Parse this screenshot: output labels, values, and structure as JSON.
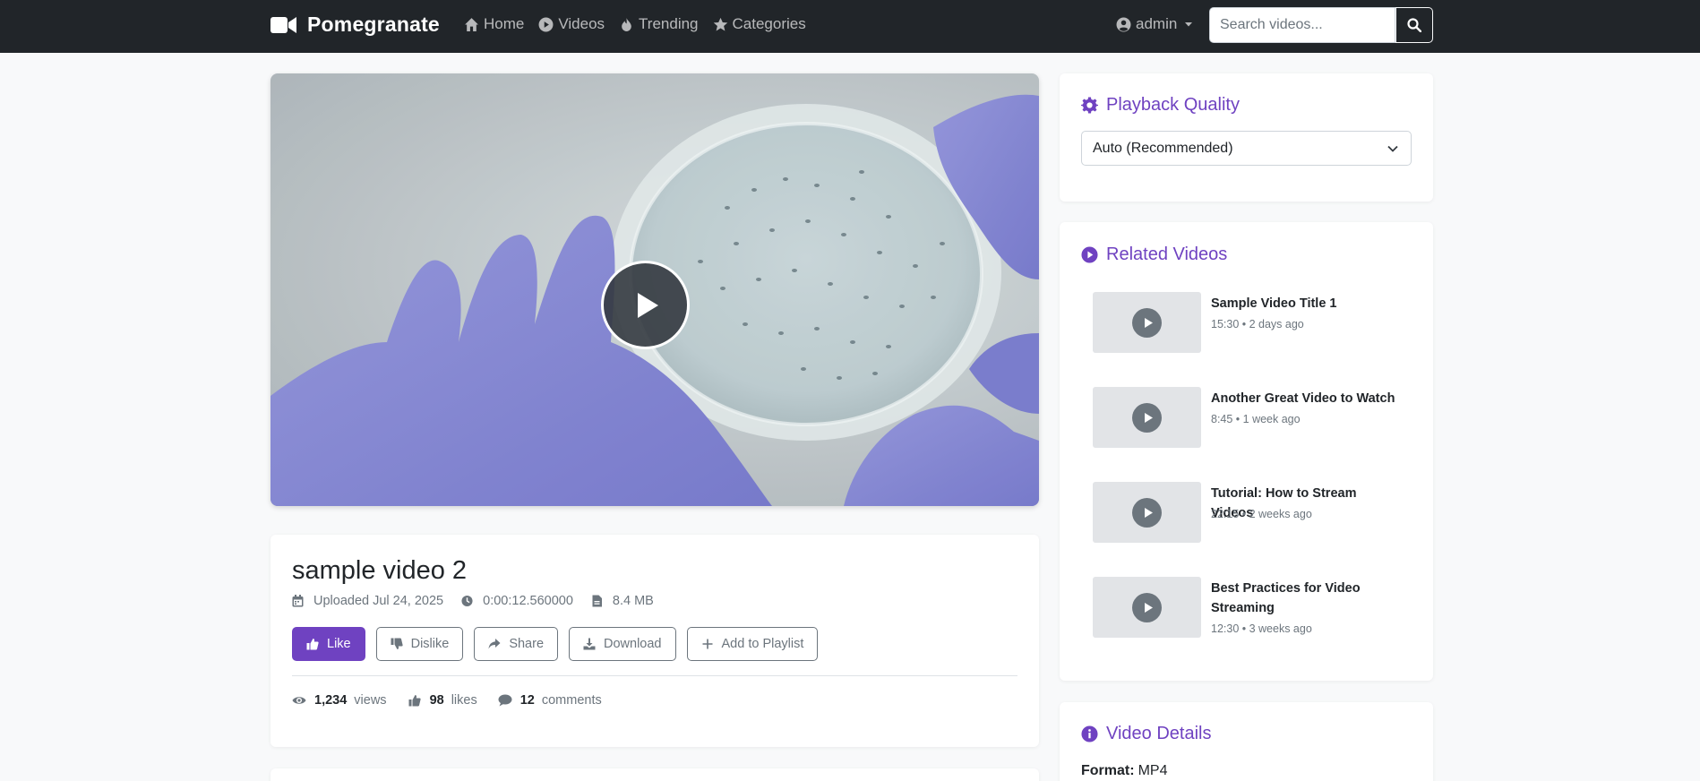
{
  "navbar": {
    "brand": "Pomegranate",
    "links": [
      {
        "label": "Home",
        "icon": "home-icon"
      },
      {
        "label": "Videos",
        "icon": "play-circle-icon"
      },
      {
        "label": "Trending",
        "icon": "fire-icon"
      },
      {
        "label": "Categories",
        "icon": "star-icon"
      }
    ],
    "user": "admin",
    "search_placeholder": "Search videos..."
  },
  "video": {
    "title": "sample video 2",
    "uploaded": "Uploaded Jul 24, 2025",
    "duration": "0:00:12.560000",
    "size": "8.4 MB",
    "actions": {
      "like": "Like",
      "dislike": "Dislike",
      "share": "Share",
      "download": "Download",
      "playlist": "Add to Playlist"
    },
    "stats": {
      "views": "1,234",
      "views_label": "views",
      "likes": "98",
      "likes_label": "likes",
      "comments": "12",
      "comments_label": "comments"
    }
  },
  "sidebar": {
    "quality": {
      "title": "Playback Quality",
      "selected": "Auto (Recommended)"
    },
    "related": {
      "title": "Related Videos",
      "items": [
        {
          "title": "Sample Video Title 1",
          "meta": "15:30 • 2 days ago"
        },
        {
          "title": "Another Great Video to Watch",
          "meta": "8:45 • 1 week ago"
        },
        {
          "title": "Tutorial: How to Stream Videos",
          "meta": "22:15 • 2 weeks ago"
        },
        {
          "title": "Best Practices for Video Streaming",
          "meta": "12:30 • 3 weeks ago"
        }
      ]
    },
    "details": {
      "title": "Video Details",
      "format_label": "Format:",
      "format_value": "MP4"
    }
  },
  "colors": {
    "navbar": "#212529",
    "accent": "#6f42c1",
    "page": "#f8f9fa"
  }
}
